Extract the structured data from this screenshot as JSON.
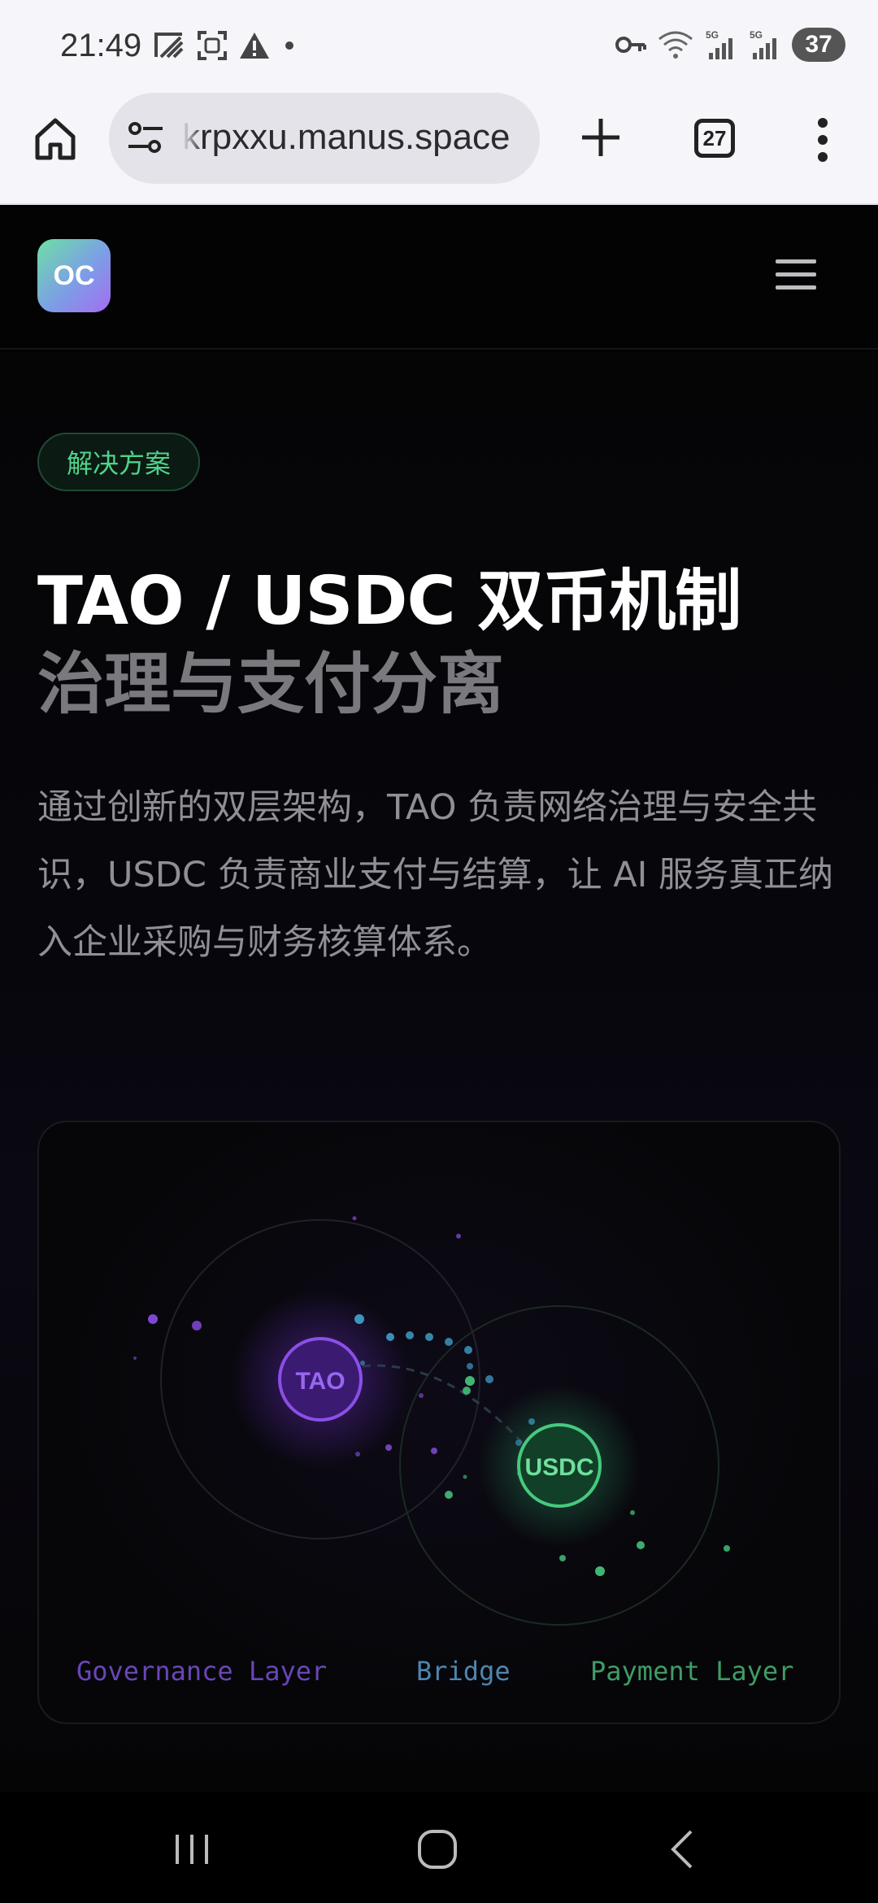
{
  "status_bar": {
    "time": "21:49",
    "battery": "37",
    "icons": [
      "ticket-icon",
      "screenshot-icon",
      "warning-icon",
      "dot-icon",
      "key-icon",
      "wifi-icon",
      "signal-5g-icon",
      "signal-5g-icon"
    ]
  },
  "browser": {
    "url": "krpxxu.manus.space",
    "tab_count": "27",
    "icons": [
      "home-icon",
      "site-settings-icon",
      "plus-icon",
      "tabs-icon",
      "more-vert-icon"
    ]
  },
  "site": {
    "logo_text": "OC",
    "menu_icon": "hamburger-icon"
  },
  "hero": {
    "badge": "解决方案",
    "title_line1": "TAO / USDC 双币机制",
    "title_line2": "治理与支付分离",
    "description": "通过创新的双层架构，TAO 负责网络治理与安全共识，USDC 负责商业支付与结算，让 AI 服务真正纳入企业采购与财务核算体系。"
  },
  "diagram": {
    "tao_label": "TAO",
    "usdc_label": "USDC",
    "governance_label": "Governance Layer",
    "bridge_label": "Bridge",
    "payment_label": "Payment Layer",
    "colors": {
      "tao": "#8b4fe6",
      "usdc": "#46c97e",
      "bridge": "#3f9cc6"
    }
  },
  "nav": {
    "icons": [
      "recent-apps-icon",
      "home-circle-icon",
      "back-icon"
    ]
  }
}
